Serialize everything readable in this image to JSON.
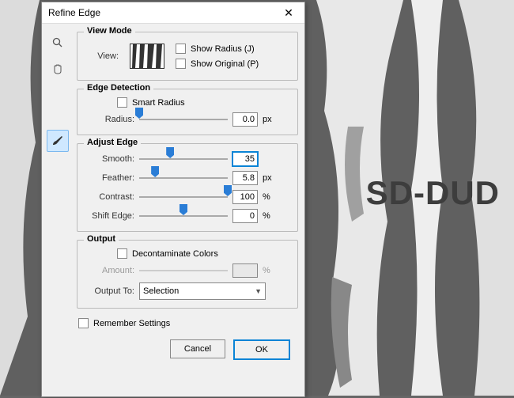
{
  "dialog": {
    "title": "Refine Edge"
  },
  "viewMode": {
    "groupTitle": "View Mode",
    "viewLabel": "View:",
    "showRadius": "Show Radius (J)",
    "showOriginal": "Show Original (P)"
  },
  "edgeDetection": {
    "groupTitle": "Edge Detection",
    "smartRadius": "Smart Radius",
    "radiusLabel": "Radius:",
    "radiusValue": "0.0",
    "radiusUnit": "px"
  },
  "adjustEdge": {
    "groupTitle": "Adjust Edge",
    "smoothLabel": "Smooth:",
    "smoothValue": "35",
    "featherLabel": "Feather:",
    "featherValue": "5.8",
    "featherUnit": "px",
    "contrastLabel": "Contrast:",
    "contrastValue": "100",
    "contrastUnit": "%",
    "shiftEdgeLabel": "Shift Edge:",
    "shiftEdgeValue": "0",
    "shiftEdgeUnit": "%"
  },
  "output": {
    "groupTitle": "Output",
    "decontaminate": "Decontaminate Colors",
    "amountLabel": "Amount:",
    "amountValue": "",
    "amountUnit": "%",
    "outputToLabel": "Output To:",
    "outputToValue": "Selection"
  },
  "footer": {
    "remember": "Remember Settings",
    "cancel": "Cancel",
    "ok": "OK"
  },
  "sliderPositions": {
    "radius": 0,
    "smooth": 35,
    "feather": 18,
    "contrast": 100,
    "shiftEdge": 50
  }
}
